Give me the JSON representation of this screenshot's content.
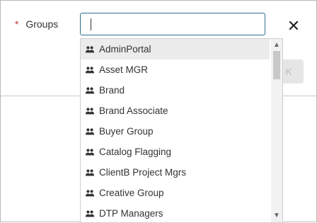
{
  "form": {
    "required_marker": "*",
    "label": "Groups",
    "input_value": "",
    "close_symbol": "✕",
    "ok_label": "K"
  },
  "dropdown": {
    "selected_index": 0,
    "options": [
      {
        "label": "AdminPortal",
        "icon": "group-icon"
      },
      {
        "label": "Asset MGR",
        "icon": "group-icon"
      },
      {
        "label": "Brand",
        "icon": "group-icon"
      },
      {
        "label": "Brand Associate",
        "icon": "group-icon"
      },
      {
        "label": "Buyer Group",
        "icon": "group-icon"
      },
      {
        "label": "Catalog Flagging",
        "icon": "group-icon"
      },
      {
        "label": "ClientB Project Mgrs",
        "icon": "group-icon"
      },
      {
        "label": "Creative Group",
        "icon": "group-icon"
      },
      {
        "label": "DTP Managers",
        "icon": "group-icon"
      }
    ]
  },
  "colors": {
    "accent": "#2f6f89",
    "required": "#c0392b",
    "highlight": "#ececec"
  }
}
